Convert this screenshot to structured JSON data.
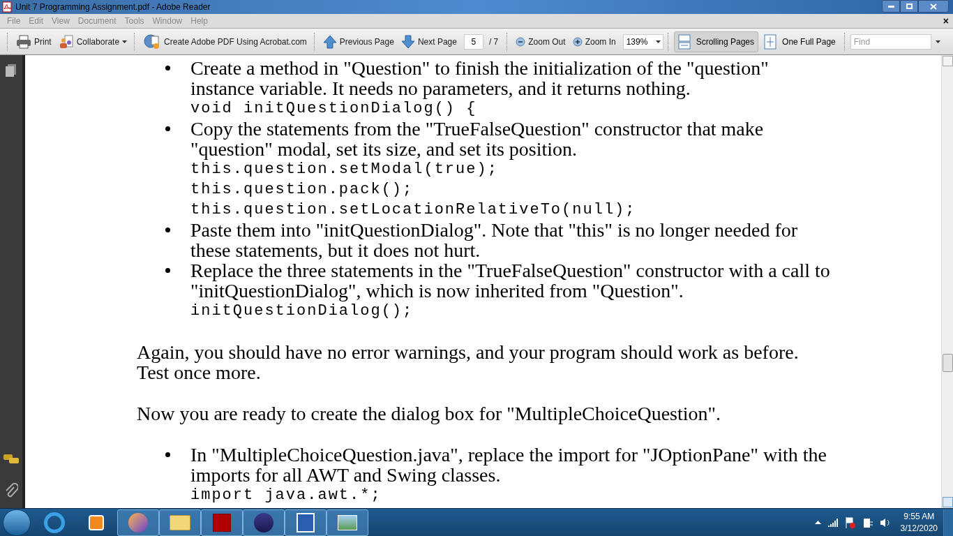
{
  "window": {
    "title": "Unit 7 Programming Assignment.pdf - Adobe Reader"
  },
  "menu": [
    "File",
    "Edit",
    "View",
    "Document",
    "Tools",
    "Window",
    "Help"
  ],
  "menu_close": "×",
  "toolbar": {
    "print": "Print",
    "collaborate": "Collaborate",
    "create_pdf": "Create Adobe PDF Using Acrobat.com",
    "previous_page": "Previous Page",
    "next_page": "Next Page",
    "page_field": {
      "value": "5"
    },
    "page_count": "/ 7",
    "zoom_out": "Zoom Out",
    "zoom_in": "Zoom In",
    "zoom_field": {
      "value": "139%"
    },
    "view_modes": [
      {
        "label": "Scrolling Pages",
        "selected": true
      },
      {
        "label": "One Full Page",
        "selected": false
      }
    ],
    "find": {
      "placeholder": "Find"
    }
  },
  "document": {
    "blocks": [
      {
        "kind": "bullet",
        "text": "Create a method in \"Question\" to finish the initialization of the \"question\" instance variable. It needs no parameters, and it returns nothing.",
        "code": [
          "void initQuestionDialog() {"
        ]
      },
      {
        "kind": "bullet",
        "text": "Copy the statements from the \"TrueFalseQuestion\" constructor that make \"question\" modal, set its size, and set its position.",
        "code": [
          "this.question.setModal(true);",
          "this.question.pack();",
          "this.question.setLocationRelativeTo(null);"
        ]
      },
      {
        "kind": "bullet",
        "text": "Paste them into \"initQuestionDialog\". Note that \"this\" is no longer needed for these statements, but it does not hurt."
      },
      {
        "kind": "bullet",
        "text": "Replace the three statements in the \"TrueFalseQuestion\" constructor with a call to \"initQuestionDialog\", which is now inherited from \"Question\".",
        "code": [
          "initQuestionDialog();"
        ]
      },
      {
        "kind": "paragraph",
        "text": "Again, you should have no error warnings, and your program should work as before. Test once more."
      },
      {
        "kind": "paragraph",
        "text": "Now you are ready to create the dialog box for \"MultipleChoiceQuestion\"."
      },
      {
        "kind": "bullet",
        "text": "In \"MultipleChoiceQuestion.java\", replace the import for \"JOptionPane\" with the imports for all AWT and Swing classes.",
        "code": [
          "import java.awt.*;"
        ]
      }
    ]
  },
  "clock": {
    "time": "9:55 AM",
    "date": "3/12/2020"
  }
}
